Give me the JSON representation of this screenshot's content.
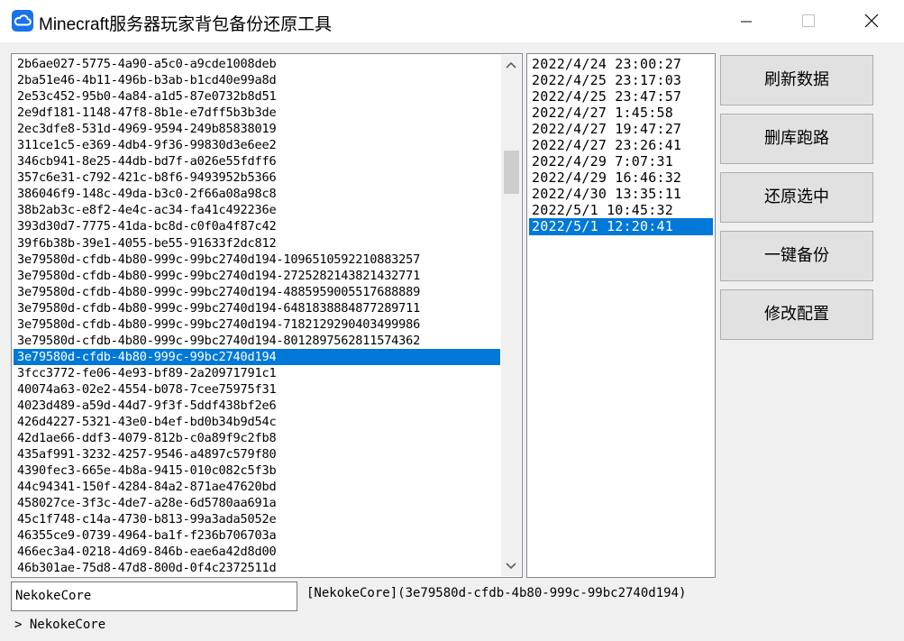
{
  "window": {
    "title": "Minecraft服务器玩家背包备份还原工具",
    "icon": "cloud-icon"
  },
  "uuid_list": {
    "items": [
      "2b6ae027-5775-4a90-a5c0-a9cde1008deb",
      "2ba51e46-4b11-496b-b3ab-b1cd40e99a8d",
      "2e53c452-95b0-4a84-a1d5-87e0732b8d51",
      "2e9df181-1148-47f8-8b1e-e7dff5b3b3de",
      "2ec3dfe8-531d-4969-9594-249b85838019",
      "311ce1c5-e369-4db4-9f36-99830d3e6ee2",
      "346cb941-8e25-44db-bd7f-a026e55fdff6",
      "357c6e31-c792-421c-b8f6-9493952b5366",
      "386046f9-148c-49da-b3c0-2f66a08a98c8",
      "38b2ab3c-e8f2-4e4c-ac34-fa41c492236e",
      "393d30d7-7775-41da-bc8d-c0f0a4f87c42",
      "39f6b38b-39e1-4055-be55-91633f2dc812",
      "3e79580d-cfdb-4b80-999c-99bc2740d194-1096510592210883257",
      "3e79580d-cfdb-4b80-999c-99bc2740d194-2725282143821432771",
      "3e79580d-cfdb-4b80-999c-99bc2740d194-4885959005517688889",
      "3e79580d-cfdb-4b80-999c-99bc2740d194-6481838884877289711",
      "3e79580d-cfdb-4b80-999c-99bc2740d194-7182129290403499986",
      "3e79580d-cfdb-4b80-999c-99bc2740d194-8012897562811574362",
      "3e79580d-cfdb-4b80-999c-99bc2740d194",
      "3fcc3772-fe06-4e93-bf89-2a20971791c1",
      "40074a63-02e2-4554-b078-7cee75975f31",
      "4023d489-a59d-44d7-9f3f-5ddf438bf2e6",
      "426d4227-5321-43e0-b4ef-bd0b34b9d54c",
      "42d1ae66-ddf3-4079-812b-c0a89f9c2fb8",
      "435af991-3232-4257-9546-a4897c579f80",
      "4390fec3-665e-4b8a-9415-010c082c5f3b",
      "44c94341-150f-4284-84a2-871ae47620bd",
      "458027ce-3f3c-4de7-a28e-6d5780aa691a",
      "45c1f748-c14a-4730-b813-99a3ada5052e",
      "46355ce9-0739-4964-ba1f-f236b706703a",
      "466ec3a4-0218-4d69-846b-eae6a42d8d00",
      "46b301ae-75d8-47d8-800d-0f4c2372511d"
    ],
    "selected_index": 18
  },
  "date_list": {
    "items": [
      "2022/4/24 23:00:27",
      "2022/4/25 23:17:03",
      "2022/4/25 23:47:57",
      "2022/4/27 1:45:58",
      "2022/4/27 19:47:27",
      "2022/4/27 23:26:41",
      "2022/4/29 7:07:31",
      "2022/4/29 16:46:32",
      "2022/4/30 13:35:11",
      "2022/5/1 10:45:32",
      "2022/5/1 12:20:41"
    ],
    "selected_index": 10
  },
  "buttons": {
    "refresh": "刷新数据",
    "delete_run": "删库跑路",
    "restore_selected": "还原选中",
    "one_click_backup": "一键备份",
    "edit_config": "修改配置"
  },
  "player_input": {
    "value": "NekokeCore"
  },
  "result_label": "[NekokeCore](3e79580d-cfdb-4b80-999c-99bc2740d194)",
  "status_line": "> NekokeCore",
  "colors": {
    "selection": "#0078d7",
    "app_icon": "#1a73e8"
  }
}
